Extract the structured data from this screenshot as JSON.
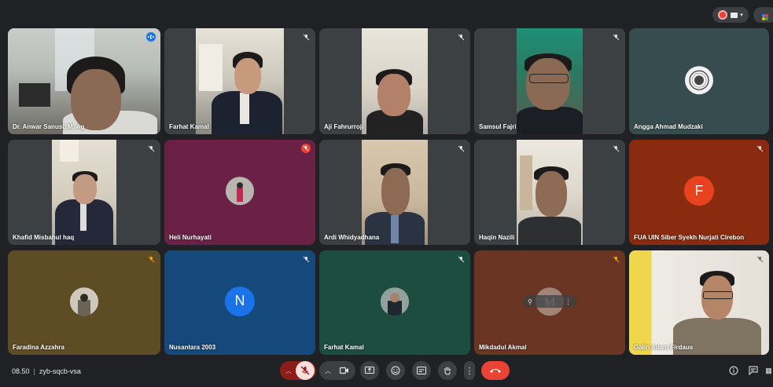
{
  "meeting": {
    "time": "08.50",
    "code": "zyb-sqcb-vsa"
  },
  "participants": [
    {
      "name": "Dr. Anwar Sanusi, M. Ag"
    },
    {
      "name": "Farhat Kamal"
    },
    {
      "name": "Aji Fahrurroji"
    },
    {
      "name": "Samsul Fajri"
    },
    {
      "name": "Angga Ahmad Mudzaki"
    },
    {
      "name": "Khafid Misbahul haq"
    },
    {
      "name": "Heli Nurhayati"
    },
    {
      "name": "Ardi Whidyadhana"
    },
    {
      "name": "Haqin Nazili"
    },
    {
      "name": "FUA UIN Siber Syekh Nurjati Cirebon",
      "initial": "F"
    },
    {
      "name": "Faradina Azzahra"
    },
    {
      "name": "Nusantara 2003",
      "initial": "N"
    },
    {
      "name": "Farhat Kamal"
    },
    {
      "name": "Mikdadul Akmal"
    },
    {
      "name": "Galih Adam Firdaus"
    }
  ],
  "colors": {
    "background": "#202124",
    "tile": "#3c4043",
    "end_call": "#ea4335",
    "active_border": "#8ab4f8"
  },
  "icons": [
    "mic-off-icon",
    "camera-icon",
    "present-icon",
    "emoji-icon",
    "captions-icon",
    "raise-hand-icon",
    "more-icon",
    "end-call-icon",
    "info-icon",
    "chat-icon"
  ]
}
